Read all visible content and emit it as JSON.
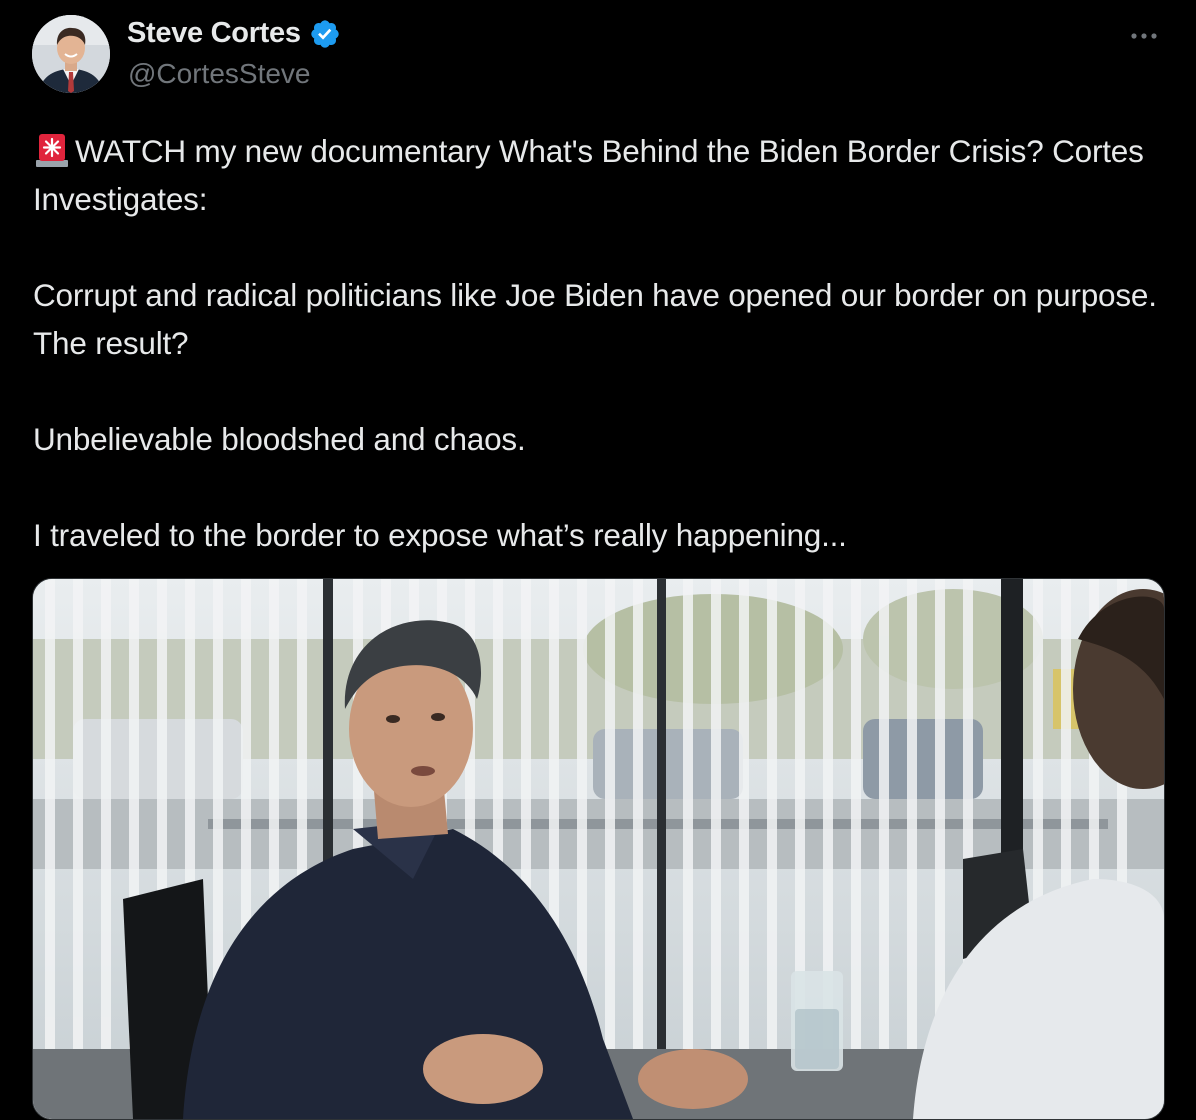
{
  "author": {
    "display_name": "Steve Cortes",
    "handle": "@CortesSteve",
    "verified": true,
    "avatar_icon": "profile-photo",
    "verified_icon": "verified-badge-icon",
    "verified_color": "#1d9bf0"
  },
  "menu": {
    "icon": "more-options-icon"
  },
  "tweet": {
    "lead_icon": "police-light-emoji-icon",
    "paragraphs": [
      "WATCH my new documentary What's Behind the Biden Border Crisis? Cortes Investigates:",
      "Corrupt and radical politicians like Joe Biden have opened our border on purpose. The result?",
      "Unbelievable bloodshed and chaos.",
      "I traveled to the border to expose what’s really happening..."
    ]
  },
  "media": {
    "type": "video-thumbnail",
    "icon": "interview-video-thumbnail"
  },
  "colors": {
    "background": "#000000",
    "text_primary": "#e7e9ea",
    "text_secondary": "#71767b",
    "accent": "#1d9bf0"
  }
}
